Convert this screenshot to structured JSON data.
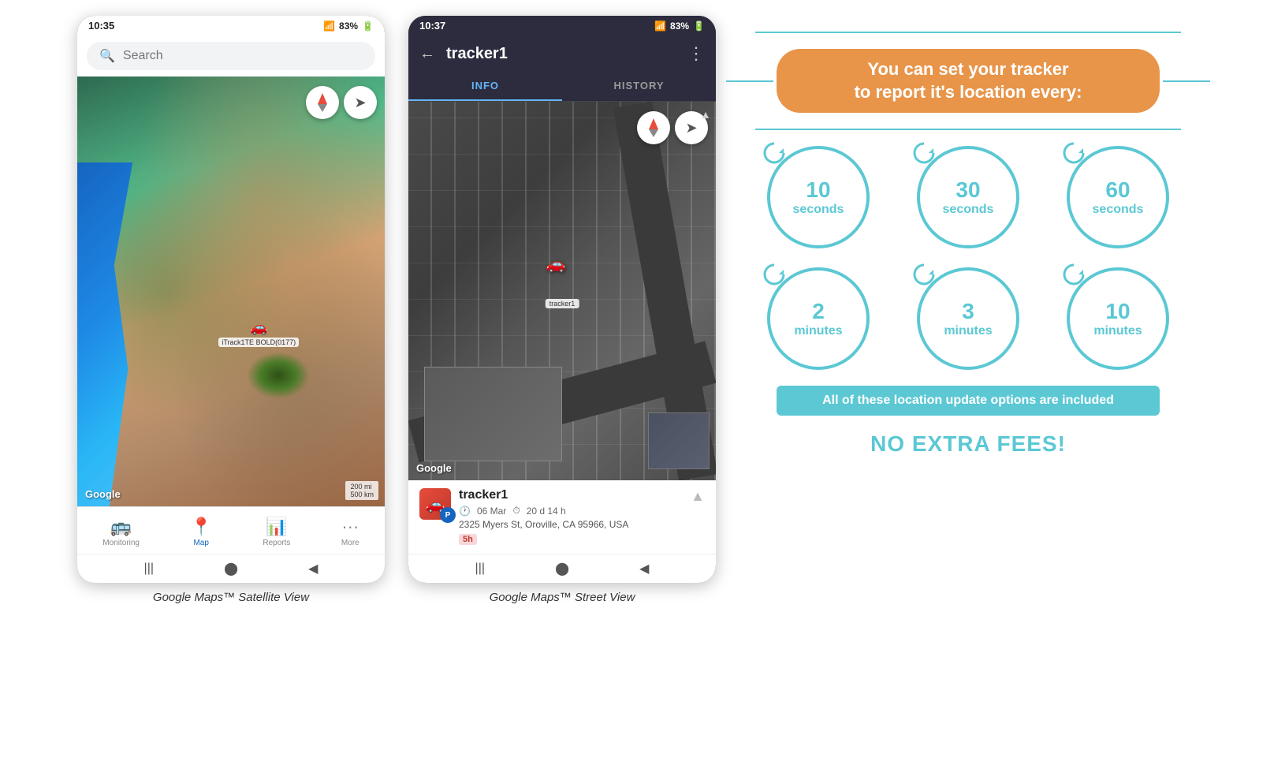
{
  "phone1": {
    "status_time": "10:35",
    "status_signal": "▲.▌▌",
    "status_battery": "83%",
    "search_placeholder": "Search",
    "nav_items": [
      {
        "label": "Monitoring",
        "icon": "🚌",
        "active": false
      },
      {
        "label": "Map",
        "icon": "📍",
        "active": true
      },
      {
        "label": "Reports",
        "icon": "📊",
        "active": false
      },
      {
        "label": "More",
        "icon": "···",
        "active": false
      }
    ],
    "tracker_label": "iTrack1TE BOLD(0177)",
    "google_label": "Google",
    "scale_label": "200 mi\n500 km",
    "caption": "Google Maps™ Satellite View"
  },
  "phone2": {
    "status_time": "10:37",
    "status_signal": "▲.▌▌",
    "status_battery": "83%",
    "title": "tracker1",
    "tab_info": "INFO",
    "tab_history": "HISTORY",
    "google_label": "Google",
    "tracker_name": "tracker1",
    "tracker_date": "06 Mar",
    "tracker_duration": "20 d 14 h",
    "tracker_address": "2325 Myers St, Oroville, CA 95966, USA",
    "tracker_badge": "5h",
    "tracker_label": "tracker1",
    "caption": "Google Maps™ Street View"
  },
  "infographic": {
    "header_line1": "You can set your tracker",
    "header_line2": "to report it's location every:",
    "intervals": [
      {
        "main": "10",
        "sub": "seconds"
      },
      {
        "main": "30",
        "sub": "seconds"
      },
      {
        "main": "60",
        "sub": "seconds"
      },
      {
        "main": "2",
        "sub": "minutes"
      },
      {
        "main": "3",
        "sub": "minutes"
      },
      {
        "main": "10",
        "sub": "minutes"
      }
    ],
    "included_text": "All of these location update options are included",
    "no_fees_text": "NO EXTRA FEES!"
  }
}
